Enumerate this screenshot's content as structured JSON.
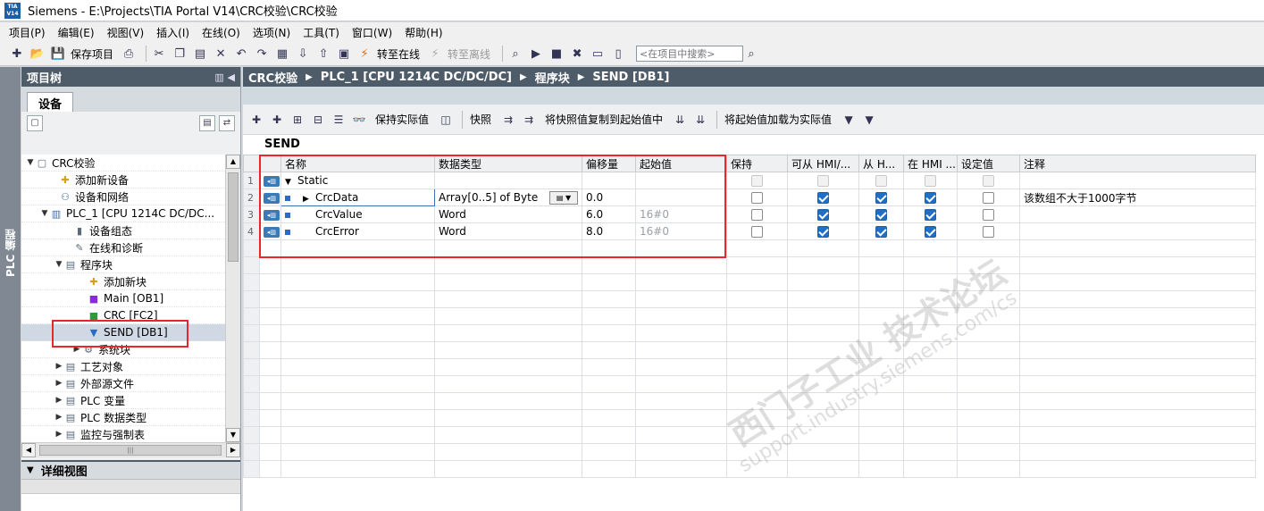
{
  "window": {
    "logo": "TIA V14",
    "title": "Siemens  -  E:\\Projects\\TIA Portal V14\\CRC校验\\CRC校验"
  },
  "menu": [
    "项目(P)",
    "编辑(E)",
    "视图(V)",
    "插入(I)",
    "在线(O)",
    "选项(N)",
    "工具(T)",
    "窗口(W)",
    "帮助(H)"
  ],
  "toolbar": {
    "save_project": "保存项目",
    "go_online": "转至在线",
    "go_offline": "转至离线",
    "search_placeholder": "<在项目中搜索>"
  },
  "side_tab": "PLC 编程",
  "tree": {
    "title": "项目树",
    "tab": "设备",
    "items": [
      {
        "label": "CRC校验",
        "icon": "project-icon",
        "arrow": "▼"
      },
      {
        "label": "添加新设备",
        "icon": "add-device-icon",
        "arrow": ""
      },
      {
        "label": "设备和网络",
        "icon": "network-icon",
        "arrow": ""
      },
      {
        "label": "PLC_1 [CPU 1214C DC/DC...",
        "icon": "plc-icon",
        "arrow": "▼"
      },
      {
        "label": "设备组态",
        "icon": "device-config-icon",
        "arrow": ""
      },
      {
        "label": "在线和诊断",
        "icon": "diagnostics-icon",
        "arrow": ""
      },
      {
        "label": "程序块",
        "icon": "folder-icon",
        "arrow": "▼"
      },
      {
        "label": "添加新块",
        "icon": "add-block-icon",
        "arrow": ""
      },
      {
        "label": "Main [OB1]",
        "icon": "ob-block-icon",
        "arrow": ""
      },
      {
        "label": "CRC [FC2]",
        "icon": "fc-block-icon",
        "arrow": ""
      },
      {
        "label": "SEND [DB1]",
        "icon": "db-block-icon",
        "arrow": ""
      },
      {
        "label": "系统块",
        "icon": "system-block-icon",
        "arrow": "▶"
      },
      {
        "label": "工艺对象",
        "icon": "folder-icon",
        "arrow": "▶"
      },
      {
        "label": "外部源文件",
        "icon": "folder-icon",
        "arrow": "▶"
      },
      {
        "label": "PLC 变量",
        "icon": "folder-icon",
        "arrow": "▶"
      },
      {
        "label": "PLC 数据类型",
        "icon": "folder-icon",
        "arrow": "▶"
      },
      {
        "label": "监控与强制表",
        "icon": "folder-icon",
        "arrow": "▶"
      }
    ],
    "selected_index": 10,
    "detail_title": "详细视图"
  },
  "editor": {
    "breadcrumb": [
      "CRC校验",
      "PLC_1 [CPU 1214C DC/DC/DC]",
      "程序块",
      "SEND [DB1]"
    ],
    "tools": {
      "keep_actual": "保持实际值",
      "snapshot": "快照",
      "copy_snapshot": "将快照值复制到起始值中",
      "load_start": "将起始值加载为实际值"
    },
    "block_title": "SEND",
    "columns": [
      "名称",
      "数据类型",
      "偏移量",
      "起始值",
      "保持",
      "可从 HMI/...",
      "从 H...",
      "在 HMI ...",
      "设定值",
      "注释"
    ],
    "rows": [
      {
        "num": "1",
        "name": "Static",
        "type": "",
        "offset": "",
        "start": "",
        "retain": false,
        "hmi_access": false,
        "hmi_visible": false,
        "hmi_setting": false,
        "setpoint": false,
        "comment": "",
        "level": 0,
        "arrow": "▼",
        "disabled": true
      },
      {
        "num": "2",
        "name": "CrcData",
        "type": "Array[0..5] of Byte",
        "offset": "0.0",
        "start": "",
        "retain": false,
        "hmi_access": true,
        "hmi_visible": true,
        "hmi_setting": true,
        "setpoint": false,
        "comment": "该数组不大于1000字节",
        "level": 1,
        "arrow": "▶",
        "disabled": false
      },
      {
        "num": "3",
        "name": "CrcValue",
        "type": "Word",
        "offset": "6.0",
        "start": "16#0",
        "retain": false,
        "hmi_access": true,
        "hmi_visible": true,
        "hmi_setting": true,
        "setpoint": false,
        "comment": "",
        "level": 1,
        "arrow": "",
        "disabled": false
      },
      {
        "num": "4",
        "name": "CrcError",
        "type": "Word",
        "offset": "8.0",
        "start": "16#0",
        "retain": false,
        "hmi_access": true,
        "hmi_visible": true,
        "hmi_setting": true,
        "setpoint": false,
        "comment": "",
        "level": 1,
        "arrow": "",
        "disabled": false
      }
    ]
  }
}
